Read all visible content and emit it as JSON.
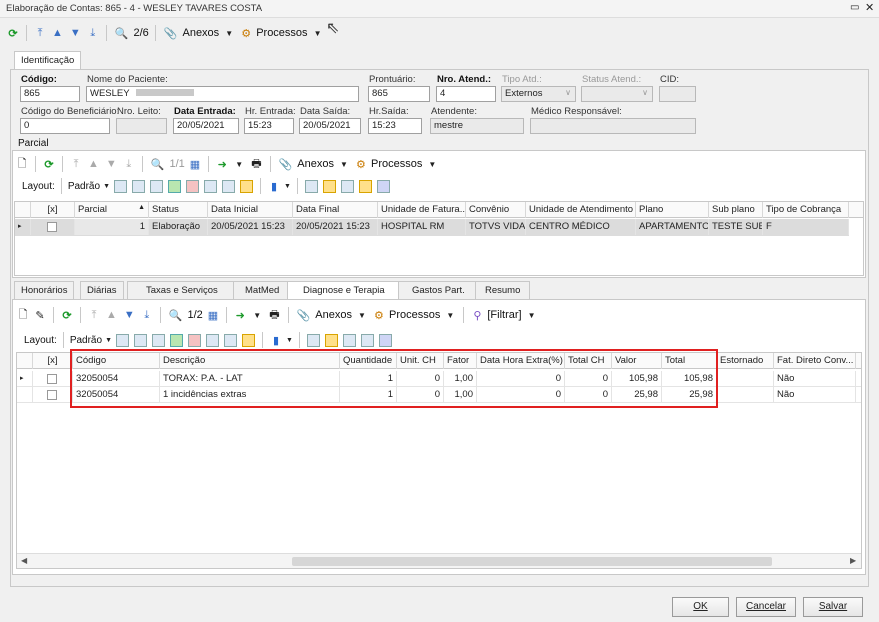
{
  "window": {
    "title": "Elaboração de Contas: 865 - 4 - WESLEY TAVARES COSTA"
  },
  "main_toolbar": {
    "record_counter": "2/6",
    "attachments_label": "Anexos",
    "processes_label": "Processos"
  },
  "top_tab": {
    "label": "Identificação"
  },
  "identification": {
    "codigo_label": "Código:",
    "codigo_value": "865",
    "nome_label": "Nome do Paciente:",
    "nome_value": "WESLEY",
    "prontuario_label": "Prontuário:",
    "prontuario_value": "865",
    "nro_atend_label": "Nro. Atend.:",
    "nro_atend_value": "4",
    "tipo_atd_label": "Tipo Atd.:",
    "tipo_atd_value": "Externos",
    "status_atend_label": "Status Atend.:",
    "status_atend_value": "",
    "cid_label": "CID:",
    "cid_value": "",
    "cod_benef_label": "Código do Beneficiário:",
    "cod_benef_value": "0",
    "nro_leito_label": "Nro. Leito:",
    "nro_leito_value": "",
    "data_entrada_label": "Data Entrada:",
    "data_entrada_value": "20/05/2021",
    "hr_entrada_label": "Hr. Entrada:",
    "hr_entrada_value": "15:23",
    "data_saida_label": "Data Saída:",
    "data_saida_value": "20/05/2021",
    "hr_saida_label": "Hr.Saída:",
    "hr_saida_value": "15:23",
    "atendente_label": "Atendente:",
    "atendente_value": "mestre",
    "medico_label": "Médico Responsável:",
    "medico_value": ""
  },
  "parcial": {
    "title": "Parcial",
    "record_counter": "1/1",
    "attachments_label": "Anexos",
    "processes_label": "Processos",
    "layout_label": "Layout:",
    "layout_value": "Padrão",
    "columns": [
      "[x]",
      "Parcial",
      "Status",
      "Data Inicial",
      "Data Final",
      "Unidade de Fatura...",
      "Convênio",
      "Unidade de Atendimento",
      "Plano",
      "Sub plano",
      "Tipo de Cobrança"
    ],
    "rows": [
      {
        "parcial": "1",
        "status": "Elaboração",
        "data_inicial": "20/05/2021 15:23",
        "data_final": "20/05/2021 15:23",
        "unidade_fatura": "HOSPITAL RM",
        "convenio": "TOTVS VIDA",
        "unidade_atend": "CENTRO MÉDICO",
        "plano": "APARTAMENTO",
        "sub_plano": "TESTE SUB",
        "tipo_cobranca": "F"
      }
    ]
  },
  "bottom_tabs": [
    "Honorários",
    "Diárias",
    "Taxas e Serviços",
    "MatMed",
    "Diagnose e Terapia",
    "Gastos Part.",
    "Resumo"
  ],
  "items": {
    "record_counter": "1/2",
    "attachments_label": "Anexos",
    "processes_label": "Processos",
    "filter_label": "[Filtrar]",
    "layout_label": "Layout:",
    "layout_value": "Padrão",
    "columns": [
      "[x]",
      "Código",
      "Descrição",
      "Quantidade",
      "Unit. CH",
      "Fator",
      "Data Hora Extra(%)",
      "Total CH",
      "Valor",
      "Total",
      "Estornado",
      "Fat. Direto Conv..."
    ],
    "rows": [
      {
        "codigo": "32050054",
        "descricao": "TORAX: P.A. - LAT",
        "quantidade": "1",
        "unit_ch": "0",
        "fator": "1,00",
        "extra": "0",
        "total_ch": "0",
        "valor": "105,98",
        "total": "105,98",
        "estornado": "",
        "fat_direto": "Não"
      },
      {
        "codigo": "32050054",
        "descricao": "1 incidências extras",
        "quantidade": "1",
        "unit_ch": "0",
        "fator": "1,00",
        "extra": "0",
        "total_ch": "0",
        "valor": "25,98",
        "total": "25,98",
        "estornado": "",
        "fat_direto": "Não"
      }
    ],
    "highlight_color": "#e02020"
  },
  "footer": {
    "ok_label": "OK",
    "cancel_label": "Cancelar",
    "save_label": "Salvar"
  }
}
